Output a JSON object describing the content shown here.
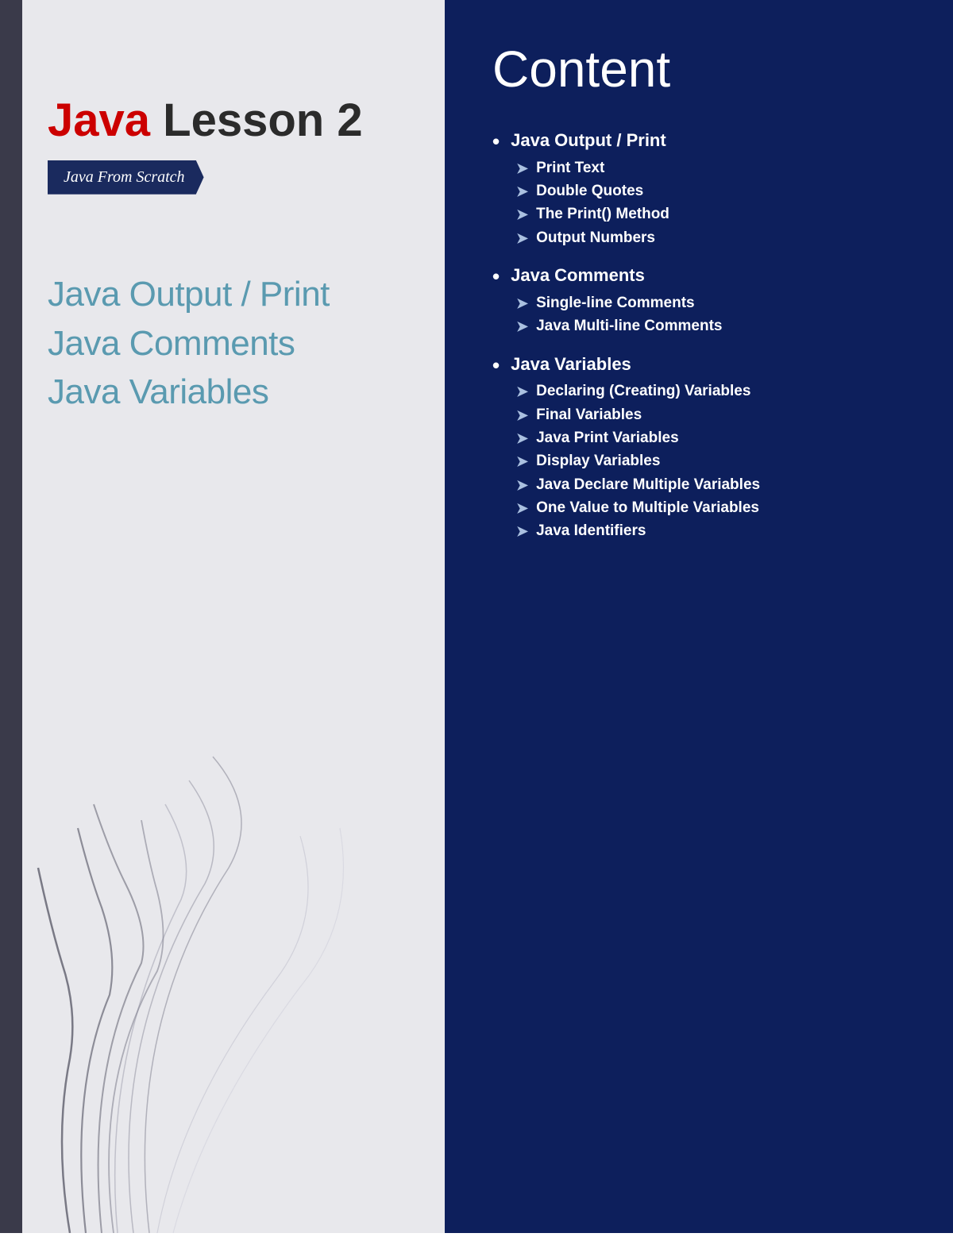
{
  "left": {
    "bar": "",
    "lesson_title_java": "Java",
    "lesson_title_rest": " Lesson 2",
    "subtitle": "Java From Scratch",
    "topics": [
      "Java Output / Print",
      "Java Comments",
      "Java Variables"
    ]
  },
  "right": {
    "content_title": "Content",
    "sections": [
      {
        "main": "Java Output / Print",
        "subs": [
          "Print Text",
          "Double Quotes",
          "The Print() Method",
          "Output Numbers"
        ]
      },
      {
        "main": "Java Comments",
        "subs": [
          "Single-line Comments",
          "Java Multi-line Comments"
        ]
      },
      {
        "main": "Java Variables",
        "subs": [
          "Declaring (Creating) Variables",
          "Final Variables",
          "Java Print Variables",
          "Display Variables",
          "Java Declare Multiple Variables",
          "One Value to Multiple Variables",
          "Java Identifiers"
        ]
      }
    ]
  }
}
